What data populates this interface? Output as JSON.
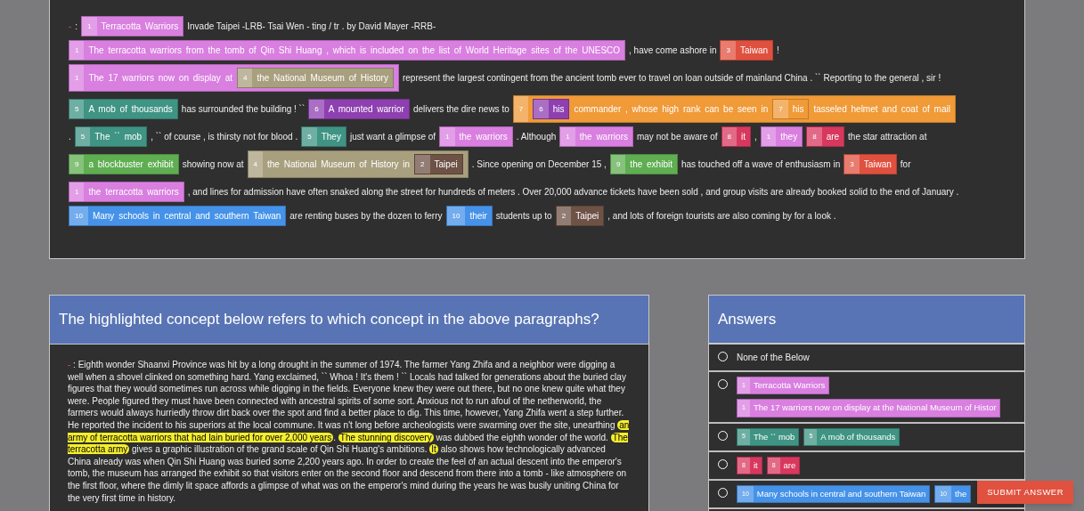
{
  "passage": {
    "lines": [
      {
        "segments": [
          {
            "kind": "marker",
            "text": "-"
          },
          {
            "kind": "text",
            "text": ":"
          },
          {
            "kind": "mention",
            "cluster": "1",
            "color": "#d97fe0",
            "children": [
              {
                "kind": "text",
                "text": "Terracotta Warriors"
              }
            ]
          },
          {
            "kind": "text",
            "text": "Invade Taipei -LRB- Tsai Wen - ting / tr . by David Mayer -RRB-"
          }
        ]
      },
      {
        "segments": [
          {
            "kind": "mention",
            "cluster": "1",
            "color": "#d97fe0",
            "children": [
              {
                "kind": "text",
                "text": "The terracotta warriors from the tomb of Qin Shi Huang , which is included on the list of World Heritage sites of the UNESCO"
              }
            ]
          },
          {
            "kind": "text",
            "text": ", have come ashore in"
          },
          {
            "kind": "mention",
            "cluster": "3",
            "color": "#e0503f",
            "children": [
              {
                "kind": "text",
                "text": "Taiwan"
              }
            ]
          },
          {
            "kind": "text",
            "text": "!"
          }
        ]
      },
      {
        "segments": [
          {
            "kind": "mention",
            "cluster": "1",
            "color": "#d97fe0",
            "children": [
              {
                "kind": "text",
                "text": "The 17 warriors now on display at"
              },
              {
                "kind": "mention",
                "cluster": "4",
                "color": "#a89f7e",
                "children": [
                  {
                    "kind": "text",
                    "text": "the National Museum of History"
                  }
                ]
              }
            ]
          },
          {
            "kind": "text",
            "text": "represent the largest contingent from the ancient tomb ever to travel on loan outside of mainland China . `` Reporting to the general , sir !"
          }
        ]
      },
      {
        "segments": [
          {
            "kind": "mention",
            "cluster": "5",
            "color": "#3f9484",
            "children": [
              {
                "kind": "text",
                "text": "A mob of thousands"
              }
            ]
          },
          {
            "kind": "text",
            "text": "has surrounded the building ! ``"
          },
          {
            "kind": "mention",
            "cluster": "6",
            "color": "#8e3fb0",
            "children": [
              {
                "kind": "text",
                "text": "A mounted warrior"
              }
            ]
          },
          {
            "kind": "text",
            "text": "delivers the dire news to"
          },
          {
            "kind": "mention",
            "cluster": "7",
            "color": "#f09a38",
            "children": [
              {
                "kind": "mention",
                "cluster": "6",
                "color": "#8e3fb0",
                "children": [
                  {
                    "kind": "text",
                    "text": "his"
                  }
                ]
              },
              {
                "kind": "text",
                "text": "commander , whose high rank can be seen in"
              },
              {
                "kind": "mention",
                "cluster": "7",
                "color": "#f09a38",
                "children": [
                  {
                    "kind": "text",
                    "text": "his"
                  }
                ]
              },
              {
                "kind": "text",
                "text": "tasseled helmet and coat of mail"
              }
            ]
          }
        ]
      },
      {
        "segments": [
          {
            "kind": "text",
            "text": "."
          },
          {
            "kind": "mention",
            "cluster": "5",
            "color": "#3f9484",
            "children": [
              {
                "kind": "text",
                "text": "The `` mob"
              }
            ]
          },
          {
            "kind": "text",
            "text": ", `` of course , is thirsty not for blood ."
          },
          {
            "kind": "mention",
            "cluster": "5",
            "color": "#3f9484",
            "children": [
              {
                "kind": "text",
                "text": "They"
              }
            ]
          },
          {
            "kind": "text",
            "text": "just want a glimpse of"
          },
          {
            "kind": "mention",
            "cluster": "1",
            "color": "#d97fe0",
            "children": [
              {
                "kind": "text",
                "text": "the warriors"
              }
            ]
          },
          {
            "kind": "text",
            "text": ". Although"
          },
          {
            "kind": "mention",
            "cluster": "1",
            "color": "#d97fe0",
            "children": [
              {
                "kind": "text",
                "text": "the warriors"
              }
            ]
          },
          {
            "kind": "text",
            "text": "may not be aware of"
          },
          {
            "kind": "mention",
            "cluster": "8",
            "color": "#d8385e",
            "children": [
              {
                "kind": "text",
                "text": "it"
              }
            ]
          },
          {
            "kind": "text",
            "text": ","
          },
          {
            "kind": "mention",
            "cluster": "1",
            "color": "#d97fe0",
            "children": [
              {
                "kind": "text",
                "text": "they"
              }
            ]
          },
          {
            "kind": "mention",
            "cluster": "8",
            "color": "#d8385e",
            "children": [
              {
                "kind": "text",
                "text": "are"
              }
            ]
          },
          {
            "kind": "text",
            "text": "the star attraction at"
          }
        ]
      },
      {
        "segments": [
          {
            "kind": "mention",
            "cluster": "9",
            "color": "#5fae52",
            "children": [
              {
                "kind": "text",
                "text": "a blockbuster exhibit"
              }
            ]
          },
          {
            "kind": "text",
            "text": "showing now at"
          },
          {
            "kind": "mention",
            "cluster": "4",
            "color": "#a89f7e",
            "children": [
              {
                "kind": "text",
                "text": "the National Museum of History in"
              },
              {
                "kind": "mention",
                "cluster": "2",
                "color": "#6e5246",
                "children": [
                  {
                    "kind": "text",
                    "text": "Taipei"
                  }
                ]
              }
            ]
          },
          {
            "kind": "text",
            "text": ". Since opening on December 15 ,"
          },
          {
            "kind": "mention",
            "cluster": "9",
            "color": "#5fae52",
            "children": [
              {
                "kind": "text",
                "text": "the exhibit"
              }
            ]
          },
          {
            "kind": "text",
            "text": "has touched off a wave of enthusiasm in"
          },
          {
            "kind": "mention",
            "cluster": "3",
            "color": "#e0503f",
            "children": [
              {
                "kind": "text",
                "text": "Taiwan"
              }
            ]
          },
          {
            "kind": "text",
            "text": "for"
          }
        ]
      },
      {
        "segments": [
          {
            "kind": "mention",
            "cluster": "1",
            "color": "#d97fe0",
            "children": [
              {
                "kind": "text",
                "text": "the terracotta warriors"
              }
            ]
          },
          {
            "kind": "text",
            "text": ", and lines for admission have often snaked along the street for hundreds of meters . Over 20,000 advance tickets have been sold , and group visits are already booked solid to the end of January ."
          }
        ]
      },
      {
        "segments": [
          {
            "kind": "mention",
            "cluster": "10",
            "color": "#4592e8",
            "children": [
              {
                "kind": "text",
                "text": "Many schools in central and southern Taiwan"
              }
            ]
          },
          {
            "kind": "text",
            "text": "are renting buses by the dozen to ferry"
          },
          {
            "kind": "mention",
            "cluster": "10",
            "color": "#4592e8",
            "children": [
              {
                "kind": "text",
                "text": "their"
              }
            ]
          },
          {
            "kind": "text",
            "text": "students up to"
          },
          {
            "kind": "mention",
            "cluster": "2",
            "color": "#6e5246",
            "children": [
              {
                "kind": "text",
                "text": "Taipei"
              }
            ]
          },
          {
            "kind": "text",
            "text": ", and lots of foreign tourists are also coming by for a look ."
          }
        ]
      }
    ]
  },
  "question": {
    "title": "The highlighted concept below refers to which concept in the above paragraphs?",
    "segments": [
      {
        "kind": "marker",
        "text": "-"
      },
      {
        "kind": "text",
        "text": " : Eighth wonder Shaanxi Province was hit by a long drought in the summer of 1974. The farmer Yang Zhifa and a neighbor were digging a well when a shovel clinked on something hard. Yang exclaimed, `` Whoa ! It's them ! `` Locals had talked for generations about the buried clay figures that they would sometimes run across while digging in the fields. Everyone knew they were out there, but no one knew quite what they were. People figured they must have been connected with ancestral spirits of some sort. Anxious not to run afoul of the netherworld, the farmers would always hurriedly throw dirt back over the spot and find a better place to dig. This time, however, Yang Zhifa went a step further. He reported the incident to his superiors at the local commune. It was n't long before archeologists were swarming over the site, unearthing "
      },
      {
        "kind": "highlight",
        "text": "an army of terracotta warriors that had lain buried for over 2,000 years"
      },
      {
        "kind": "text",
        "text": ". "
      },
      {
        "kind": "highlight",
        "text": "The stunning discovery"
      },
      {
        "kind": "text",
        "text": " was dubbed the eighth wonder of the world. "
      },
      {
        "kind": "highlight",
        "text": "The terracotta army"
      },
      {
        "kind": "text",
        "text": " gives a graphic illustration of the grand scale of Qin Shi Huang's ambitions. "
      },
      {
        "kind": "highlight",
        "text": "It"
      },
      {
        "kind": "text",
        "text": " also shows how technologically advanced China already was when Qin Shi Huang was buried some 2,200 years ago. In order to create the feel of an actual descent into the emperor's tomb, the museum has arranged the exhibit so that visitors enter on the second floor and descend from there into a tomb - like atmosphere on the first floor, where the dimly lit space affords a glimpse of what was on the emperor's mind during the years he was busily uniting China for the very first time in history."
      }
    ]
  },
  "answers": {
    "title": "Answers",
    "options": [
      {
        "selected": false,
        "kind": "text",
        "text": "None of the Below"
      },
      {
        "selected": false,
        "kind": "mentions",
        "mentions": [
          {
            "cluster": "1",
            "color": "#d97fe0",
            "text": "Terracotta Warriors"
          },
          {
            "cluster": "1",
            "color": "#d97fe0",
            "text": "The 17 warriors now on display at the National Museum of Histor"
          }
        ]
      },
      {
        "selected": false,
        "kind": "mentions",
        "mentions": [
          {
            "cluster": "5",
            "color": "#3f9484",
            "text": "The `` mob"
          },
          {
            "cluster": "5",
            "color": "#3f9484",
            "text": "A mob of thousands"
          }
        ]
      },
      {
        "selected": false,
        "kind": "mentions",
        "mentions": [
          {
            "cluster": "8",
            "color": "#d8385e",
            "text": "it"
          },
          {
            "cluster": "8",
            "color": "#d8385e",
            "text": "are"
          }
        ]
      },
      {
        "selected": false,
        "kind": "mentions",
        "mentions": [
          {
            "cluster": "10",
            "color": "#4592e8",
            "text": "Many schools in central and southern Taiwan"
          },
          {
            "cluster": "10",
            "color": "#4592e8",
            "text": "the"
          }
        ]
      }
    ]
  },
  "submit_button": "SUBMIT ANSWER"
}
